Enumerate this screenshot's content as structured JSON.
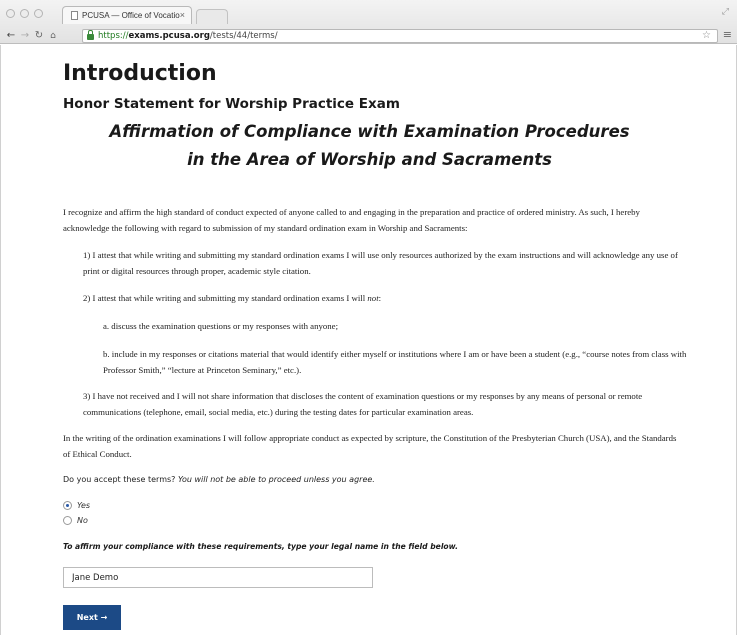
{
  "browser": {
    "tab_title": "PCUSA — Office of Vocatio",
    "tab_close": "×",
    "url_scheme": "https://",
    "url_host": "exams.pcusa.org",
    "url_path": "/tests/44/terms/"
  },
  "header": {
    "title": "Introduction",
    "subtitle": "Honor Statement for Worship Practice Exam",
    "affirmation_line1": "Affirmation of Compliance with Examination Procedures",
    "affirmation_line2": "in the Area of Worship and Sacraments"
  },
  "body": {
    "intro": "I recognize and affirm the high standard of conduct expected of anyone called to and engaging in the preparation and practice of ordered ministry.  As such, I hereby acknowledge the following with regard to submission of my standard ordination exam in Worship and Sacraments:",
    "item1": "1)    I attest that while writing and submitting my standard ordination exams I will use only resources authorized by the exam instructions and will acknowledge any use of print or digital resources through proper, academic style citation.",
    "item2_prefix": "2)    I attest that while writing and submitting my standard ordination exams I will ",
    "item2_emph": "not",
    "item2_suffix": ":",
    "item2a": "a. discuss the examination questions or my responses with anyone;",
    "item2b": "b. include in my responses or citations material that would identify either myself or institutions where I am or have been a student (e.g., “course notes from class with Professor Smith,” “lecture at Princeton Seminary,” etc.).",
    "item3": "3)    I have not received and I will not share information that discloses the content of examination questions or my responses by any means of personal or remote communications (telephone, email, social media, etc.) during the testing dates for particular examination areas.",
    "conduct": "In the writing of the ordination examinations I will follow appropriate conduct as expected by scripture, the Constitution of the Presbyterian Church (USA), and the Standards of Ethical Conduct."
  },
  "form": {
    "question": "Do you accept these terms? ",
    "question_note": "You will not be able to proceed unless you agree.",
    "option_yes": "Yes",
    "option_no": "No",
    "selected": "Yes",
    "instruction": "To affirm your compliance with these requirements, type your legal name in the field below.",
    "name_value": "Jane Demo",
    "next_label": "Next →"
  },
  "colors": {
    "button_bg": "#1c4a86",
    "url_secure": "#1f7a1f"
  }
}
